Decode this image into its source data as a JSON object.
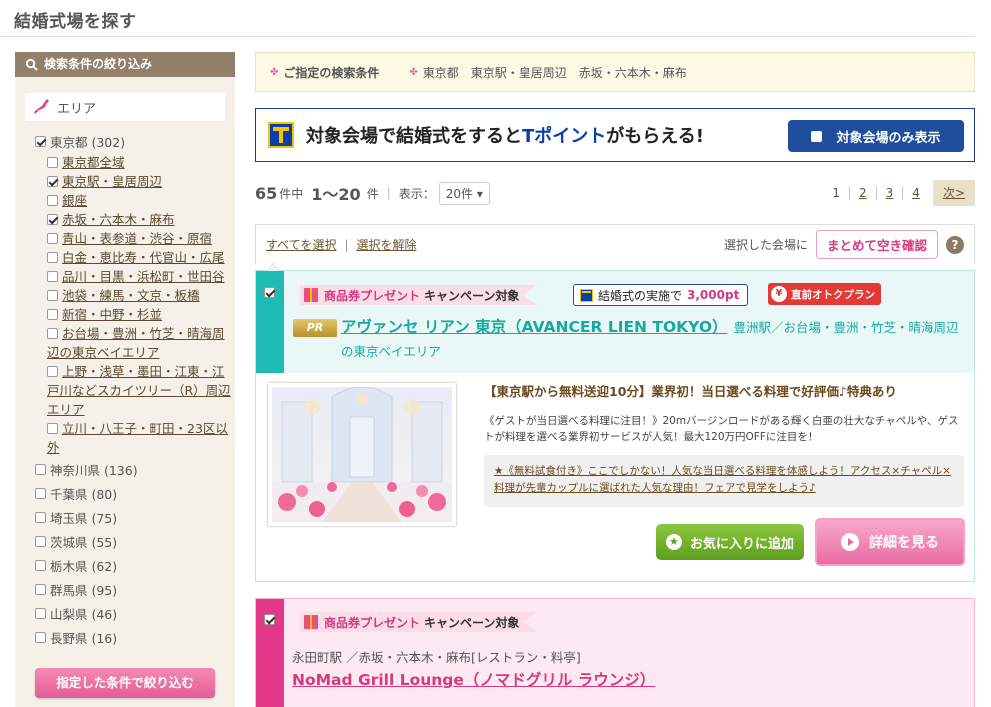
{
  "page": {
    "title": "結婚式場を探す"
  },
  "sidebar": {
    "heading": "検索条件の絞り込み",
    "area_label": "エリア",
    "prefectures": [
      {
        "label": "東京都 (302)",
        "checked": true
      },
      {
        "label": "神奈川県 (136)",
        "checked": false
      },
      {
        "label": "千葉県 (80)",
        "checked": false
      },
      {
        "label": "埼玉県 (75)",
        "checked": false
      },
      {
        "label": "茨城県 (55)",
        "checked": false
      },
      {
        "label": "栃木県 (62)",
        "checked": false
      },
      {
        "label": "群馬県 (95)",
        "checked": false
      },
      {
        "label": "山梨県 (46)",
        "checked": false
      },
      {
        "label": "長野県 (16)",
        "checked": false
      }
    ],
    "tokyo_areas": [
      {
        "label": "東京都全域",
        "checked": false
      },
      {
        "label": "東京駅・皇居周辺",
        "checked": true
      },
      {
        "label": "銀座",
        "checked": false
      },
      {
        "label": "赤坂・六本木・麻布",
        "checked": true
      },
      {
        "label": "青山・表参道・渋谷・原宿",
        "checked": false
      },
      {
        "label": "白金・恵比寿・代官山・広尾",
        "checked": false
      },
      {
        "label": "品川・目黒・浜松町・世田谷",
        "checked": false
      },
      {
        "label": "池袋・練馬・文京・板橋",
        "checked": false
      },
      {
        "label": "新宿・中野・杉並",
        "checked": false
      },
      {
        "label": "お台場・豊洲・竹芝・晴海周辺の東京ベイエリア",
        "checked": false
      },
      {
        "label": "上野・浅草・墨田・江東・江戸川などスカイツリー（R）周辺エリア",
        "checked": false
      },
      {
        "label": "立川・八王子・町田・23区以外",
        "checked": false
      }
    ],
    "filter_button": "指定した条件で絞り込む"
  },
  "conditions": {
    "label": "ご指定の検索条件",
    "value": "東京都　東京駅・皇居周辺　赤坂・六本木・麻布"
  },
  "tpoint_banner": {
    "text_prefix": "対象会場で結婚式をすると",
    "text_highlight": "Tポイント",
    "text_suffix": "がもらえる!",
    "button": "対象会場のみ表示"
  },
  "results": {
    "total": "65",
    "total_unit": "件中",
    "range": "1〜20",
    "range_unit": "件",
    "display_label": "表示：",
    "per_page": "20件 ▾",
    "pages": [
      "1",
      "2",
      "3",
      "4"
    ],
    "current_page": "1",
    "next": "次>"
  },
  "selection": {
    "select_all": "すべてを選択",
    "deselect": "選択を解除",
    "selected_label": "選択した会場に",
    "check_button": "まとめて空き確認",
    "help": "?"
  },
  "venues": [
    {
      "campaign_pink": "商品券プレゼント",
      "campaign_rest": "キャンペーン対象",
      "tpoint_tag": "結婚式の実施で",
      "tpoint_amount": "3,000pt",
      "deal_tag": "直前オトクプラン",
      "pr": "PR",
      "name": "アヴァンセ リアン 東京（AVANCER LIEN TOKYO）",
      "location": "豊洲駅／お台場・豊洲・竹芝・晴海周辺の東京ベイエリア",
      "catch": "【東京駅から無料送迎10分】業界初！当日選べる料理で好評価♪特典あり",
      "description": "《ゲストが当日選べる料理に注目！》20mバージンロードがある輝く白亜の壮大なチャペルや、ゲストが料理を選べる業界初サービスが人気！最大120万円OFFに注目を！",
      "fair": "★《無料試食付き》ここでしかない！人気な当日選べる料理を体感しよう！アクセス×チャペル×料理が先輩カップルに選ばれた人気な理由！フェアで見学をしよう♪",
      "favorite_button": "お気に入りに追加",
      "detail_button": "詳細を見る"
    },
    {
      "campaign_pink": "商品券プレゼント",
      "campaign_rest": "キャンペーン対象",
      "location": "永田町駅 ／赤坂・六本木・麻布[レストラン・料亭]",
      "name": "NoMad Grill Lounge（ノマドグリル ラウンジ）"
    }
  ],
  "colors": {
    "accent_pink": "#d6397e",
    "teal": "#1fbcb5",
    "tpoint_blue": "#1e4e9c",
    "sidebar_head": "#93806a"
  }
}
